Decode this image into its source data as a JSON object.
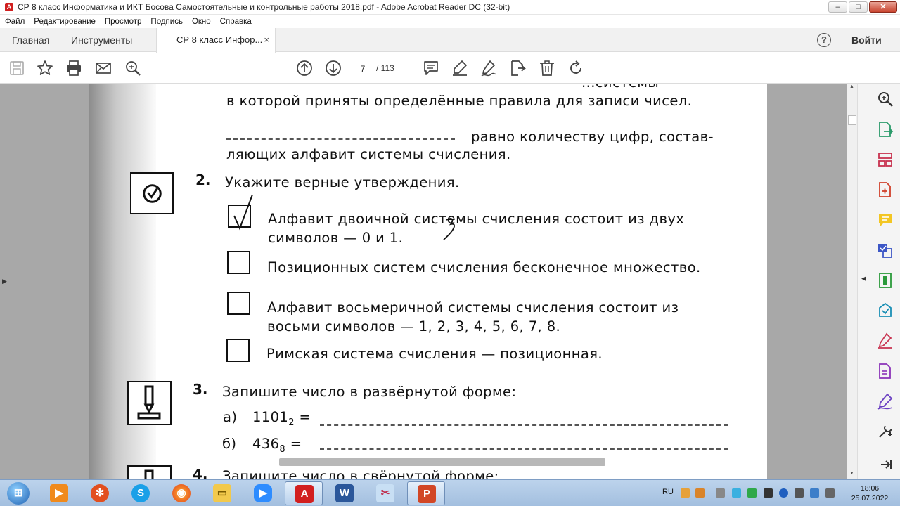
{
  "window": {
    "title": "СР 8 класс Информатика и ИКТ Босова Самостоятельные и контрольные работы 2018.pdf - Adobe Acrobat Reader DC (32-bit)",
    "minimize": "–",
    "maximize": "□",
    "close": "✕"
  },
  "menu": [
    "Файл",
    "Редактирование",
    "Просмотр",
    "Подпись",
    "Окно",
    "Справка"
  ],
  "tabs": {
    "home": "Главная",
    "tools": "Инструменты",
    "document": "СР 8 класс Инфор...",
    "close": "×",
    "help": "?",
    "signin": "Войти"
  },
  "toolbar": {
    "page_current": "7",
    "page_total": "/ 113",
    "icons": [
      "save-icon",
      "star-icon",
      "print-icon",
      "email-icon",
      "search-icon",
      "page-up-icon",
      "page-down-icon",
      "comment-icon",
      "highlight-icon",
      "sign-icon",
      "share-icon",
      "delete-icon",
      "rotate-icon"
    ]
  },
  "document": {
    "line_top_partial": "...системы",
    "line1": "в которой приняты определённые правила для записи чисел.",
    "line2": "равно количеству цифр, состав-",
    "line3": "ляющих алфавит системы счисления.",
    "q2": {
      "number": "2.",
      "prompt": "Укажите верные утверждения.",
      "options": [
        {
          "line1": "Алфавит двоичной системы счисления состоит из двух",
          "line2": "символов — 0 и 1.",
          "checked": true
        },
        {
          "line1": "Позиционных систем счисления бесконечное множество.",
          "line2": "",
          "checked": false
        },
        {
          "line1": "Алфавит восьмеричной системы счисления состоит из",
          "line2": "восьми символов — 1, 2, 3, 4, 5, 6, 7, 8.",
          "checked": false
        },
        {
          "line1": "Римская система счисления — позиционная.",
          "line2": "",
          "checked": false
        }
      ]
    },
    "q3": {
      "number": "3.",
      "prompt": "Запишите число в развёрнутой форме:",
      "a_label": "а)",
      "a_value": "1101",
      "a_base": "2",
      "b_label": "б)",
      "b_value": "436",
      "b_base": "8",
      "equals": "="
    },
    "q4": {
      "number": "4.",
      "prompt": "Запишите число в свёрнутой форме:"
    }
  },
  "right_panel_icons": [
    "zoom-tool-icon",
    "export-pdf-icon",
    "organize-pages-icon",
    "create-pdf-icon",
    "comment-tool-icon",
    "combine-files-icon",
    "compress-icon",
    "edit-pdf-icon",
    "fill-sign-icon",
    "protect-icon",
    "send-sign-icon",
    "more-tools-icon",
    "collapse-panel-icon"
  ],
  "taskbar": {
    "language": "RU",
    "time": "18:06",
    "date": "25.07.2022",
    "apps": [
      "start-orb",
      "media-player",
      "app-dots",
      "skype",
      "firefox",
      "file-explorer",
      "zoom",
      "acrobat-reader",
      "word",
      "scissors-tool",
      "powerpoint-recorder"
    ]
  }
}
